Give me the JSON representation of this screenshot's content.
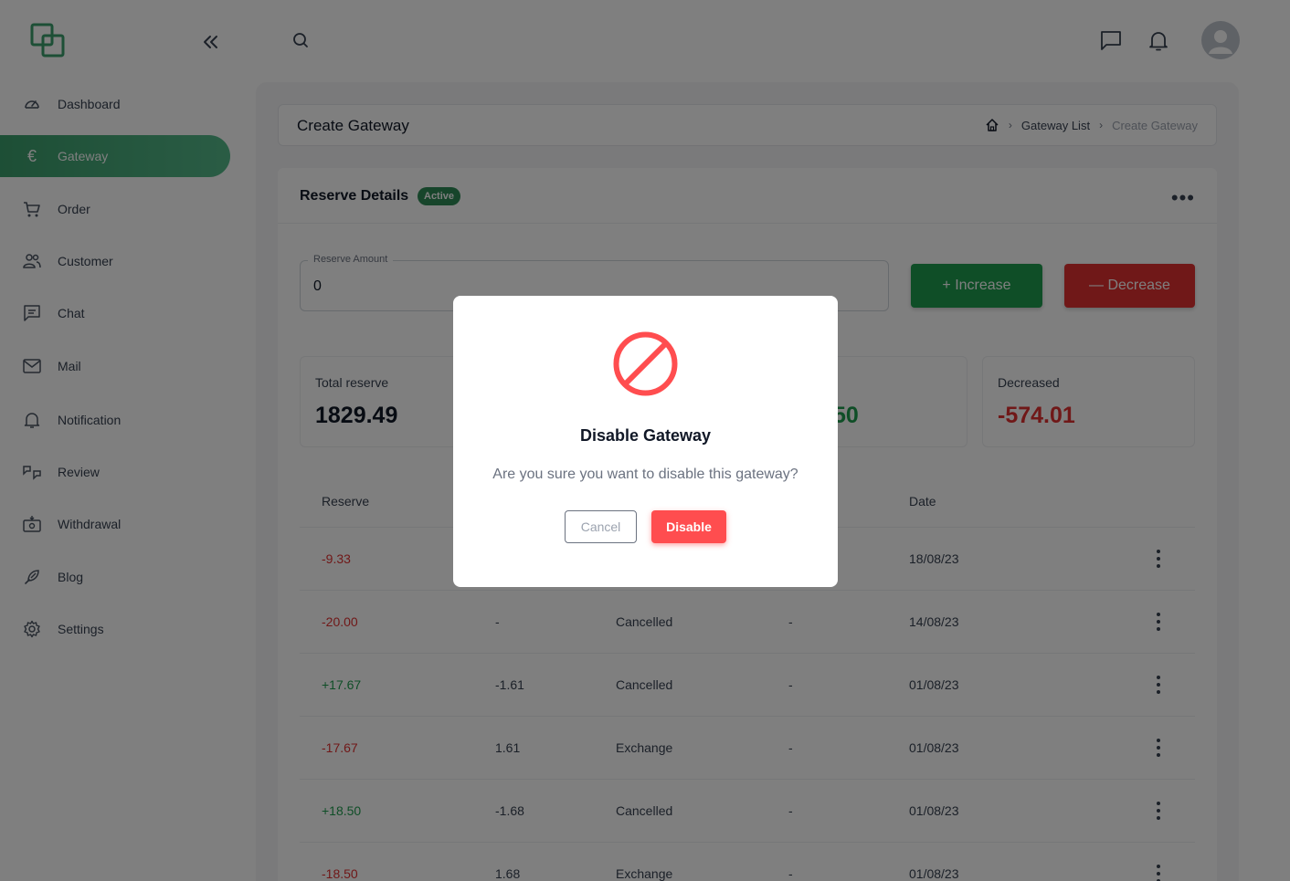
{
  "sidebar": {
    "items": [
      {
        "label": "Dashboard",
        "icon": "gauge-icon"
      },
      {
        "label": "Gateway",
        "icon": "euro-icon"
      },
      {
        "label": "Order",
        "icon": "cart-icon"
      },
      {
        "label": "Customer",
        "icon": "users-icon"
      },
      {
        "label": "Chat",
        "icon": "chat-icon"
      },
      {
        "label": "Mail",
        "icon": "mail-icon"
      },
      {
        "label": "Notification",
        "icon": "bell-icon"
      },
      {
        "label": "Review",
        "icon": "review-icon"
      },
      {
        "label": "Withdrawal",
        "icon": "withdrawal-icon"
      },
      {
        "label": "Blog",
        "icon": "blog-icon"
      },
      {
        "label": "Settings",
        "icon": "gear-icon"
      }
    ],
    "active": "Gateway",
    "euro_glyph": "€"
  },
  "header": {
    "title": "Create Gateway",
    "breadcrumb": [
      "Gateway List",
      "Create Gateway"
    ]
  },
  "reserve": {
    "title": "Reserve Details",
    "status": "Active",
    "field_label": "Reserve Amount",
    "field_value": "0",
    "increase_label": "+ Increase",
    "decrease_label": "— Decrease"
  },
  "stats": {
    "total_label": "Total reserve",
    "total_value": "1829.49",
    "increased_partial": "50",
    "decreased_label": "Decreased",
    "decreased_value": "-574.01"
  },
  "table": {
    "headers": {
      "reserve": "Reserve",
      "date": "Date"
    },
    "rows": [
      {
        "reserve": "-9.33",
        "fee": "",
        "status": "",
        "note": "",
        "date": "18/08/23"
      },
      {
        "reserve": "-20.00",
        "fee": "-",
        "status": "Cancelled",
        "note": "-",
        "date": "14/08/23"
      },
      {
        "reserve": "+17.67",
        "fee": "-1.61",
        "status": "Cancelled",
        "note": "-",
        "date": "01/08/23"
      },
      {
        "reserve": "-17.67",
        "fee": "1.61",
        "status": "Exchange",
        "note": "-",
        "date": "01/08/23"
      },
      {
        "reserve": "+18.50",
        "fee": "-1.68",
        "status": "Cancelled",
        "note": "-",
        "date": "01/08/23"
      },
      {
        "reserve": "-18.50",
        "fee": "1.68",
        "status": "Exchange",
        "note": "-",
        "date": "01/08/23"
      }
    ]
  },
  "modal": {
    "title": "Disable Gateway",
    "message": "Are you sure you want to disable this gateway?",
    "cancel_label": "Cancel",
    "confirm_label": "Disable"
  },
  "colors": {
    "accent": "#3b9e6c",
    "positive": "#1f9d4f",
    "negative": "#e03131",
    "danger_button": "#ff4d4f"
  }
}
